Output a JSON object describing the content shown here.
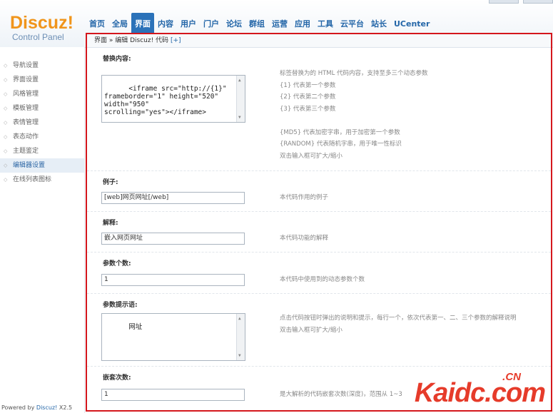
{
  "logo": {
    "brand": "Discuz!",
    "subtitle": "Control Panel"
  },
  "nav": [
    "首页",
    "全局",
    "界面",
    "内容",
    "用户",
    "门户",
    "论坛",
    "群组",
    "运营",
    "应用",
    "工具",
    "云平台",
    "站长",
    "UCenter"
  ],
  "nav_active": "界面",
  "sidebar": {
    "items": [
      "导航设置",
      "界面设置",
      "风格管理",
      "模板管理",
      "表情管理",
      "表态动作",
      "主题鉴定",
      "编辑器设置",
      "在线列表图标"
    ],
    "active_index": 7
  },
  "powered": {
    "prefix": "Powered by ",
    "name": "Discuz!",
    "version": " X2.5"
  },
  "breadcrumb": {
    "path": "界面 » 编辑 Discuz! 代码",
    "action": "[+]"
  },
  "form": {
    "replace": {
      "label": "替换内容:",
      "value": "<iframe src=\"http://{1}\"\nframeborder=\"1\" height=\"520\"\nwidth=\"950\"\nscrolling=\"yes\"></iframe>",
      "tips": [
        "标签替换为的 HTML 代码内容，支持至多三个动态参数",
        "{1} 代表第一个参数",
        "{2} 代表第二个参数",
        "{3} 代表第三个参数",
        "",
        "{MD5} 代表加密字串，用于加密第一个参数",
        "{RANDOM} 代表随机字串，用于唯一性标识",
        "双击输入框可扩大/缩小"
      ]
    },
    "example": {
      "label": "例子:",
      "value": "[web]网页网址[/web]",
      "tip": "本代码作用的例子"
    },
    "explanation": {
      "label": "解释:",
      "value": "嵌入网页网址",
      "tip": "本代码功能的解释"
    },
    "params": {
      "label": "参数个数:",
      "value": "1",
      "tip": "本代码中使用到的动态参数个数"
    },
    "prompt": {
      "label": "参数提示语:",
      "value": "网址",
      "tips": [
        "点击代码按钮时弹出的说明和提示，每行一个，依次代表第一、二、三个参数的解释说明",
        "双击输入框可扩大/缩小"
      ]
    },
    "nesting": {
      "label": "嵌套次数:",
      "value": "1",
      "tip": "是大解析的代码嵌套次数(深度)，范围从 1~3"
    }
  },
  "watermark": {
    "top": ".CN",
    "bottom": "Kaidc.com"
  },
  "colors": {
    "accent": "#2b72b9",
    "highlight_border": "#d4161c",
    "brand_orange": "#f0951b"
  }
}
